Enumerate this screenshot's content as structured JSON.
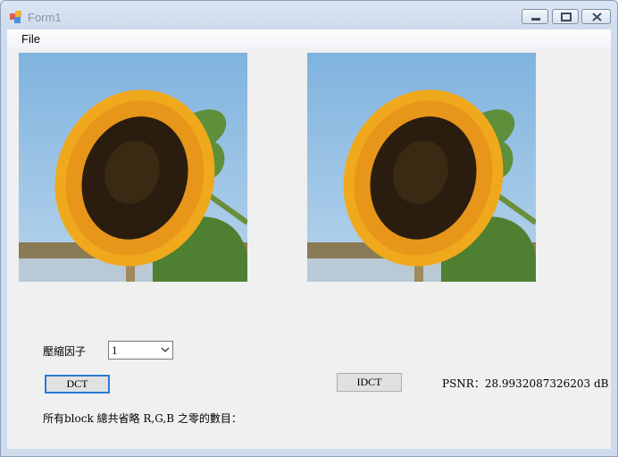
{
  "window": {
    "title": "Form1"
  },
  "menu": {
    "file": "File"
  },
  "images": {
    "original_alt": "sunflower-original",
    "reconstructed_alt": "sunflower-reconstructed"
  },
  "controls": {
    "compression_label": "壓縮因子",
    "compression_value": "1",
    "dct_button": "DCT",
    "idct_button": "IDCT",
    "psnr_text": "PSNR：28.9932087326203 dB",
    "zeros_label": "所有block 總共省略 R,G,B 之零的數目："
  },
  "icons": [
    "app-icon",
    "minimize-icon",
    "maximize-icon",
    "close-icon",
    "chevron-down-icon"
  ]
}
